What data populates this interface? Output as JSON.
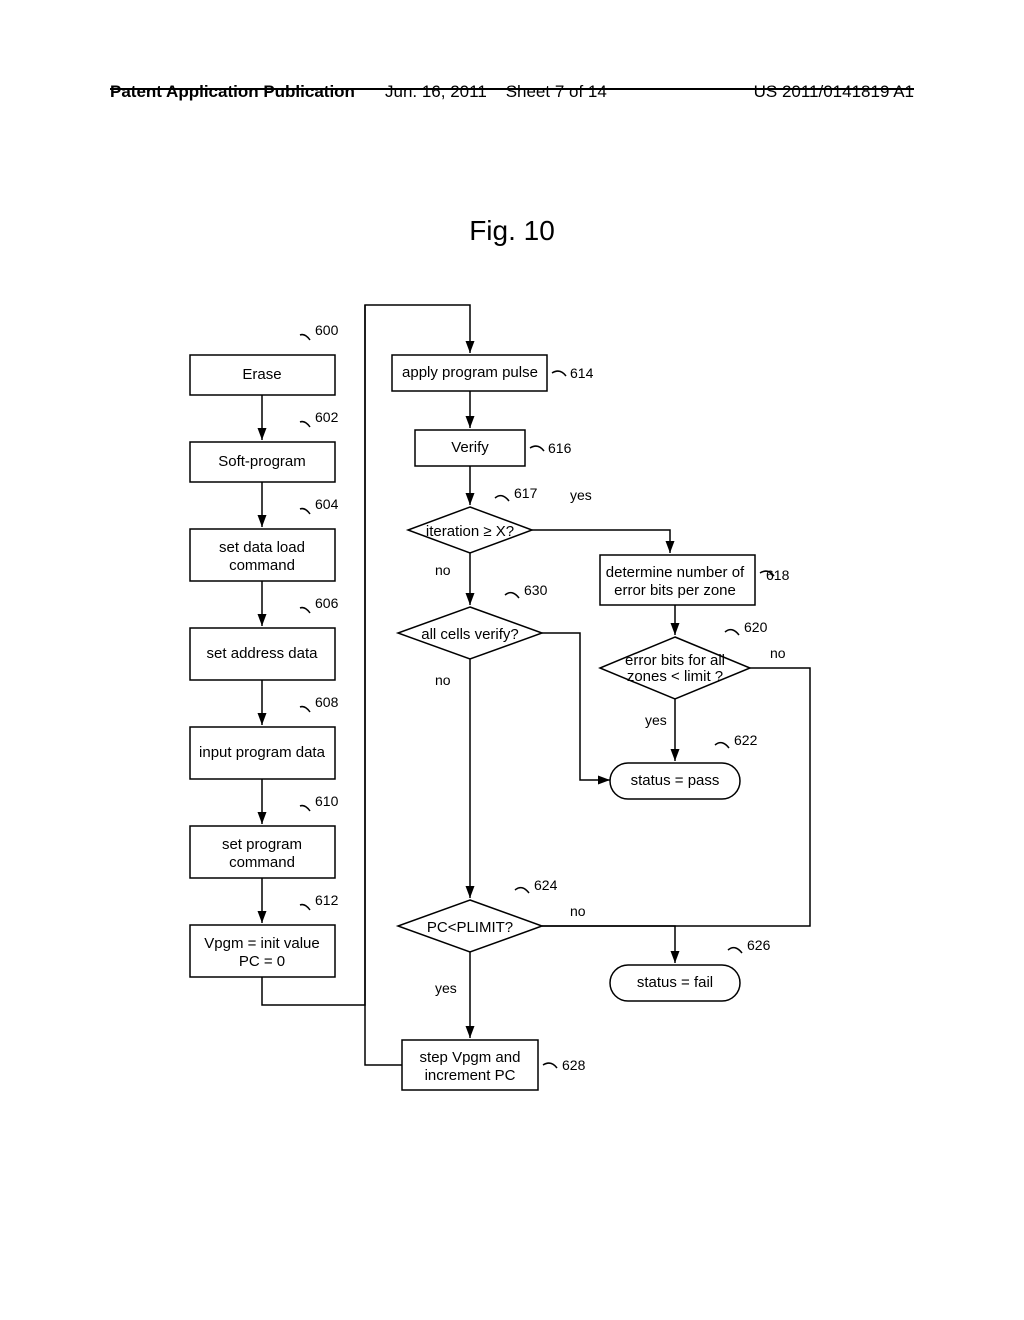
{
  "header": {
    "left": "Patent Application Publication",
    "mid_date": "Jun. 16, 2011",
    "mid_sheet": "Sheet 7 of 14",
    "right": "US 2011/0141819 A1"
  },
  "figure_title": "Fig. 10",
  "nodes": {
    "n600": {
      "ref": "600",
      "text": "Erase"
    },
    "n602": {
      "ref": "602",
      "text": "Soft-program"
    },
    "n604": {
      "ref": "604",
      "text1": "set data load",
      "text2": "command"
    },
    "n606": {
      "ref": "606",
      "text": "set address data"
    },
    "n608": {
      "ref": "608",
      "text": "input program data"
    },
    "n610": {
      "ref": "610",
      "text1": "set program",
      "text2": "command"
    },
    "n612": {
      "ref": "612",
      "text1": "Vpgm = init value",
      "text2": "PC = 0"
    },
    "n614": {
      "ref": "614",
      "text": "apply program pulse"
    },
    "n616": {
      "ref": "616",
      "text": "Verify"
    },
    "n617": {
      "ref": "617",
      "text": "iteration ≥ X?",
      "yes": "yes",
      "no": "no"
    },
    "n618": {
      "ref": "618",
      "text1": "determine number of",
      "text2": "error bits per zone"
    },
    "n620": {
      "ref": "620",
      "text1": "error bits for all",
      "text2": "zones < limit ?",
      "yes": "yes",
      "no": "no"
    },
    "n622": {
      "ref": "622",
      "text": "status = pass"
    },
    "n624": {
      "ref": "624",
      "text": "PC<PLIMIT?",
      "yes": "yes",
      "no": "no"
    },
    "n626": {
      "ref": "626",
      "text": "status = fail"
    },
    "n628": {
      "ref": "628",
      "text1": "step Vpgm and",
      "text2": "increment PC"
    },
    "n630": {
      "ref": "630",
      "text": "all cells verify?",
      "no": "no"
    }
  }
}
